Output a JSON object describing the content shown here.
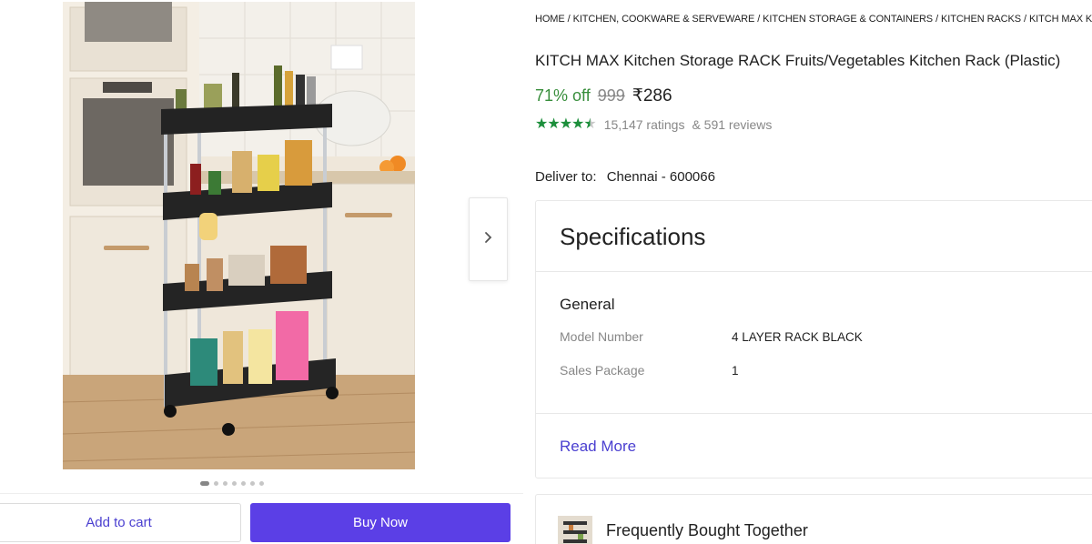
{
  "gallery": {
    "image_alt": "KITCH MAX Kitchen Storage RACK",
    "next_icon": "chevron-right-icon",
    "dot_count": 7,
    "active_dot": 0
  },
  "actions": {
    "add_to_cart": "Add to cart",
    "buy_now": "Buy Now"
  },
  "breadcrumb": [
    "HOME",
    "KITCHEN, COOKWARE & SERVEWARE",
    "KITCHEN STORAGE & CONTAINERS",
    "KITCHEN RACKS",
    "KITCH MAX KITCH"
  ],
  "product": {
    "title": "KITCH MAX Kitchen Storage RACK Fruits/Vegetables Kitchen Rack (Plastic)",
    "discount": "71% off",
    "mrp": "999",
    "price": "₹286",
    "rating_stars": 4.5,
    "ratings_text": "15,147 ratings",
    "reviews_text": "& 591 reviews"
  },
  "delivery": {
    "label": "Deliver to:",
    "location": "Chennai - 600066"
  },
  "specifications": {
    "heading": "Specifications",
    "group": "General",
    "rows": [
      {
        "key": "Model Number",
        "value": "4 LAYER RACK BLACK"
      },
      {
        "key": "Sales Package",
        "value": "1"
      }
    ],
    "read_more": "Read More"
  },
  "fbt": {
    "title": "Frequently Bought Together"
  },
  "colors": {
    "accent": "#5b3fe6",
    "discount_green": "#388e3c",
    "star_green": "#1c8f3b"
  }
}
